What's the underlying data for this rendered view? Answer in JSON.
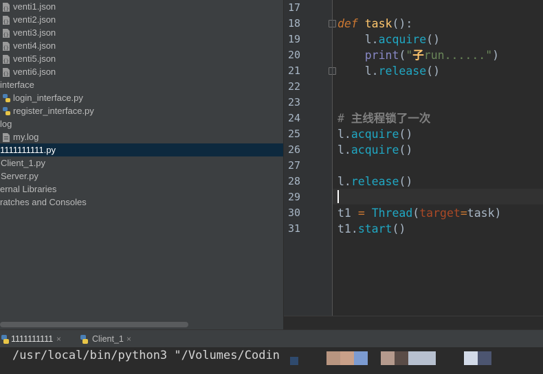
{
  "project": {
    "items": [
      {
        "label": "venti1.json",
        "icon": "json-file-icon",
        "indent": 19,
        "selected": false
      },
      {
        "label": "venti2.json",
        "icon": "json-file-icon",
        "indent": 19,
        "selected": false
      },
      {
        "label": "venti3.json",
        "icon": "json-file-icon",
        "indent": 19,
        "selected": false
      },
      {
        "label": "venti4.json",
        "icon": "json-file-icon",
        "indent": 19,
        "selected": false
      },
      {
        "label": "venti5.json",
        "icon": "json-file-icon",
        "indent": 19,
        "selected": false
      },
      {
        "label": "venti6.json",
        "icon": "json-file-icon",
        "indent": 19,
        "selected": false
      },
      {
        "label": "interface",
        "icon": "",
        "indent": 0,
        "selected": false
      },
      {
        "label": "login_interface.py",
        "icon": "python-file-icon",
        "indent": 19,
        "selected": false
      },
      {
        "label": "register_interface.py",
        "icon": "python-file-icon",
        "indent": 19,
        "selected": false
      },
      {
        "label": "log",
        "icon": "",
        "indent": 0,
        "selected": false
      },
      {
        "label": "my.log",
        "icon": "text-file-icon",
        "indent": 19,
        "selected": false
      },
      {
        "label": "1111111111.py",
        "icon": "",
        "indent": 0,
        "selected": true
      },
      {
        "label": "Client_1.py",
        "icon": "",
        "indent": 1,
        "selected": false
      },
      {
        "label": "Server.py",
        "icon": "",
        "indent": 1,
        "selected": false
      },
      {
        "label": "ernal Libraries",
        "icon": "",
        "indent": 0,
        "selected": false
      },
      {
        "label": "ratches and Consoles",
        "icon": "",
        "indent": 0,
        "selected": false
      }
    ]
  },
  "editor": {
    "line_numbers": [
      "17",
      "18",
      "19",
      "20",
      "21",
      "22",
      "23",
      "24",
      "25",
      "26",
      "27",
      "28",
      "29",
      "30",
      "31"
    ],
    "current_line": "29",
    "code": {
      "l18": {
        "kw": "def",
        "name": "task",
        "rest": "():"
      },
      "l19": {
        "obj": "l.",
        "method": "acquire",
        "rest": "()"
      },
      "l20": {
        "builtin": "print",
        "open": "(",
        "q1": "\"",
        "cjk": "子",
        "str": "run......",
        "q2": "\"",
        "close": ")"
      },
      "l21": {
        "obj": "l.",
        "method": "release",
        "rest": "()"
      },
      "l24": {
        "hash": "# ",
        "text": "主线程锁了一次"
      },
      "l25": {
        "obj": "l.",
        "method": "acquire",
        "rest": "()"
      },
      "l26": {
        "obj": "l.",
        "method": "acquire",
        "rest": "()"
      },
      "l28": {
        "obj": "l.",
        "method": "release",
        "rest": "()"
      },
      "l30": {
        "var": "t1 ",
        "eq": "=",
        "sp": " ",
        "cls": "Thread",
        "open": "(",
        "param": "target",
        "eq2": "=",
        "arg": "task",
        "close": ")"
      },
      "l31": {
        "var": "t1.",
        "method": "start",
        "rest": "()"
      }
    }
  },
  "run": {
    "tabs": [
      {
        "label": "1111111111",
        "active": true
      },
      {
        "label": "Client_1",
        "active": false
      }
    ],
    "close_glyph": "×",
    "console_text": "/usr/local/bin/python3 \"/Volumes/Codin"
  },
  "colors": {
    "project_bg": "#3c3f41",
    "editor_bg": "#2b2b2b",
    "selection": "#0d293e",
    "keyword": "#cc7832",
    "function": "#ffc66d",
    "string": "#6a8759"
  }
}
